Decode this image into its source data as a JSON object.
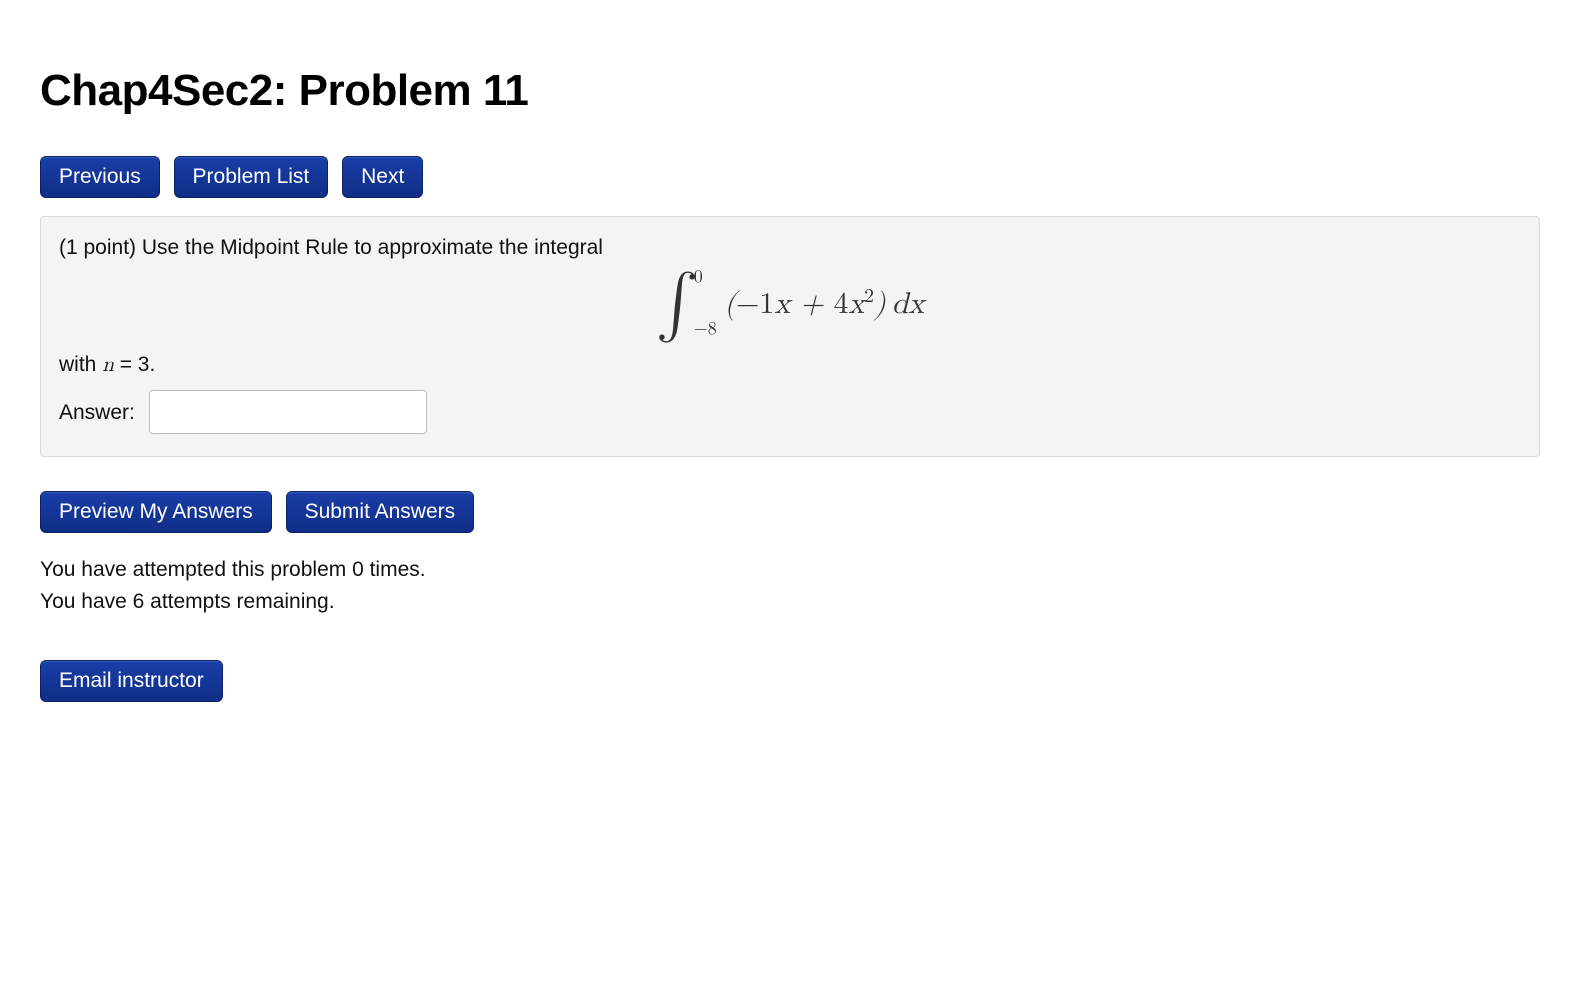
{
  "title": "Chap4Sec2: Problem 11",
  "nav": {
    "previous": "Previous",
    "problem_list": "Problem List",
    "next": "Next"
  },
  "problem": {
    "intro": "(1 point) Use the Midpoint Rule to approximate the integral",
    "integral": {
      "lower": "−8",
      "upper": "0",
      "integrand_text": "(−1x + 4x²) dx"
    },
    "with_n_prefix": "with ",
    "with_n_var": "n",
    "with_n_eq": " = 3.",
    "answer_label": "Answer:",
    "answer_value": ""
  },
  "actions": {
    "preview": "Preview My Answers",
    "submit": "Submit Answers"
  },
  "status": {
    "attempted": "You have attempted this problem 0 times.",
    "remaining": "You have 6 attempts remaining."
  },
  "email": {
    "label": "Email instructor"
  }
}
